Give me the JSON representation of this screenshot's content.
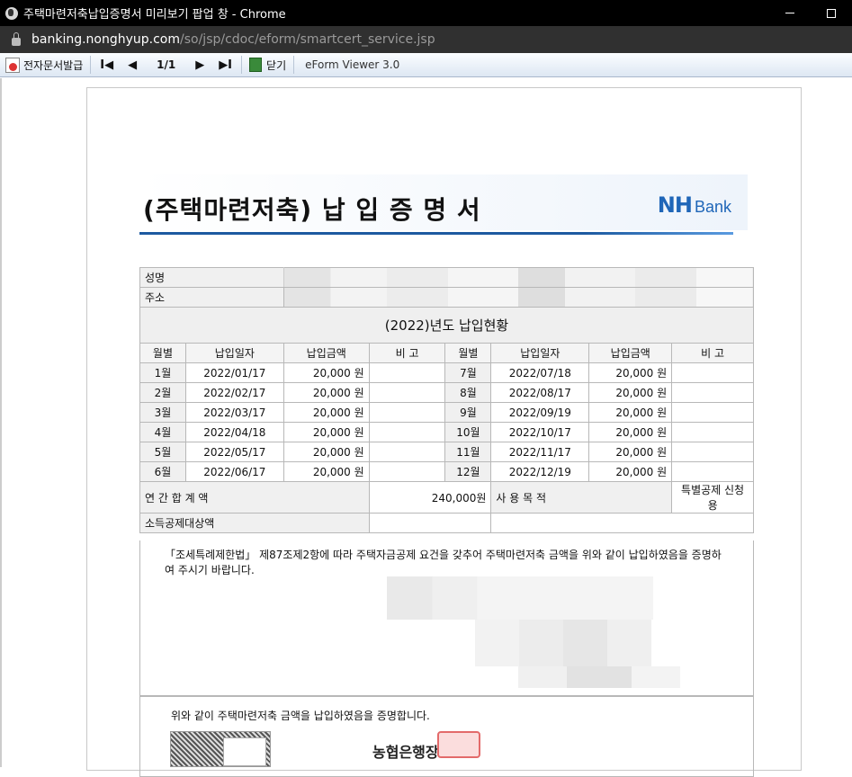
{
  "window": {
    "title": "주택마련저축납입증명서 미리보기 팝업 창 - Chrome"
  },
  "address": {
    "host": "banking.nonghyup.com",
    "path": "/so/jsp/cdoc/eform/smartcert_service.jsp"
  },
  "toolbar": {
    "issue_label": "전자문서발급",
    "page_indicator": "1/1",
    "close_label": "닫기",
    "viewer_label": "eForm Viewer 3.0",
    "first_glyph": "I◀",
    "prev_glyph": "◀",
    "next_glyph": "▶",
    "last_glyph": "▶I"
  },
  "document": {
    "title": "(주택마련저축) 납 입 증 명 서",
    "logo_nh": "NH",
    "logo_bank": "Bank",
    "name_label": "성명",
    "address_label": "주소",
    "section_title": "(2022)년도 납입현황",
    "col_month": "월별",
    "col_date": "납입일자",
    "col_amount": "납입금액",
    "col_note": "비 고",
    "payments_left": [
      {
        "month": "1월",
        "date": "2022/01/17",
        "amount": "20,000 원"
      },
      {
        "month": "2월",
        "date": "2022/02/17",
        "amount": "20,000 원"
      },
      {
        "month": "3월",
        "date": "2022/03/17",
        "amount": "20,000 원"
      },
      {
        "month": "4월",
        "date": "2022/04/18",
        "amount": "20,000 원"
      },
      {
        "month": "5월",
        "date": "2022/05/17",
        "amount": "20,000 원"
      },
      {
        "month": "6월",
        "date": "2022/06/17",
        "amount": "20,000 원"
      }
    ],
    "payments_right": [
      {
        "month": "7월",
        "date": "2022/07/18",
        "amount": "20,000 원"
      },
      {
        "month": "8월",
        "date": "2022/08/17",
        "amount": "20,000 원"
      },
      {
        "month": "9월",
        "date": "2022/09/19",
        "amount": "20,000 원"
      },
      {
        "month": "10월",
        "date": "2022/10/17",
        "amount": "20,000 원"
      },
      {
        "month": "11월",
        "date": "2022/11/17",
        "amount": "20,000 원"
      },
      {
        "month": "12월",
        "date": "2022/12/19",
        "amount": "20,000 원"
      }
    ],
    "annual_total_label": "연 간 합 계 액",
    "annual_total_value": "240,000원",
    "purpose_label": "사 용 목 적",
    "purpose_value": "특별공제 신청용",
    "deduction_label": "소득공제대상액",
    "statement": "「조세특례제한법」 제87조제2항에 따라 주택자금공제 요건을 갖추어 주택마련저축 금액을 위와 같이 납입하였음을 증명하여 주시기 바랍니다.",
    "footer_statement": "위와 같이 주택마련저축 금액을 납입하였음을 증명합니다.",
    "issuer_partial": "농협은행장"
  }
}
